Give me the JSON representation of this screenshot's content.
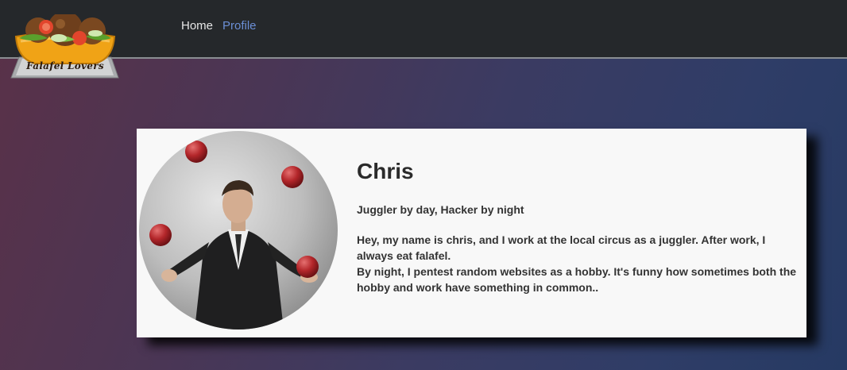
{
  "brand": {
    "logo_text": "Falafel Lovers"
  },
  "nav": {
    "items": [
      {
        "label": "Home",
        "active": false
      },
      {
        "label": "Profile",
        "active": true
      }
    ],
    "active_color": "#6b8fd6"
  },
  "profile": {
    "name": "Chris",
    "tagline": "Juggler by day, Hacker by night",
    "bio_lines": [
      "Hey, my name is chris, and I work at the local circus as a juggler. After work, I always eat falafel.",
      "By night, I pentest random websites as a hobby. It's funny how sometimes both the hobby and work have something in common.."
    ]
  }
}
